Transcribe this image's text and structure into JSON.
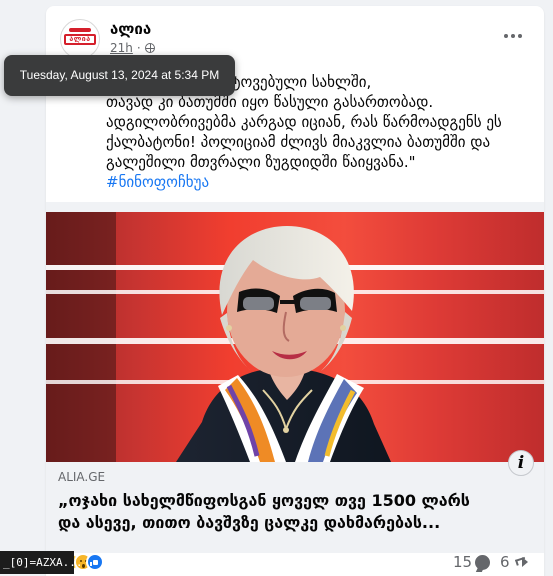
{
  "post": {
    "page_name": "ალია",
    "time": "21h",
    "tooltip_time": "Tuesday, August 13, 2024 at 5:34 PM",
    "text_lines": [
      "მარტო ჰყავდა მიტოვებული სახლში,",
      "თავად კი ბათუმში იყო წასული გასართობად.",
      "ადგილობრივებმა კარგად იციან, რას წარმოადგენს ეს",
      "ქალბატონი! პოლიციამ ძლივს მიაკვლია ბათუმში და",
      "გალეშილი მთვრალი ზუგდიდში წაიყვანა.\""
    ],
    "hashtag": "#ნინოფოჩხუა",
    "avatar_text": "ალია"
  },
  "link_preview": {
    "domain": "ALIA.GE",
    "title_lines": [
      "„ოჯახი სახელმწიფოსგან ყოველ თვე 1500 ლარს",
      "და ასევე, თითო ბავშვზე ცალკე დახმარებას..."
    ],
    "info_icon": "i"
  },
  "engagement": {
    "comments": "15",
    "shares": "6"
  },
  "debug": {
    "label": "_[0]=AZXA..."
  },
  "colors": {
    "link_blue": "#1877f2",
    "text": "#050505",
    "muted": "#65676b",
    "brand_red": "#d51f2b"
  },
  "icons": {
    "more": "more-horizontal-icon",
    "globe": "globe-icon",
    "comment": "comment-icon",
    "share": "share-icon",
    "info": "info-icon"
  }
}
